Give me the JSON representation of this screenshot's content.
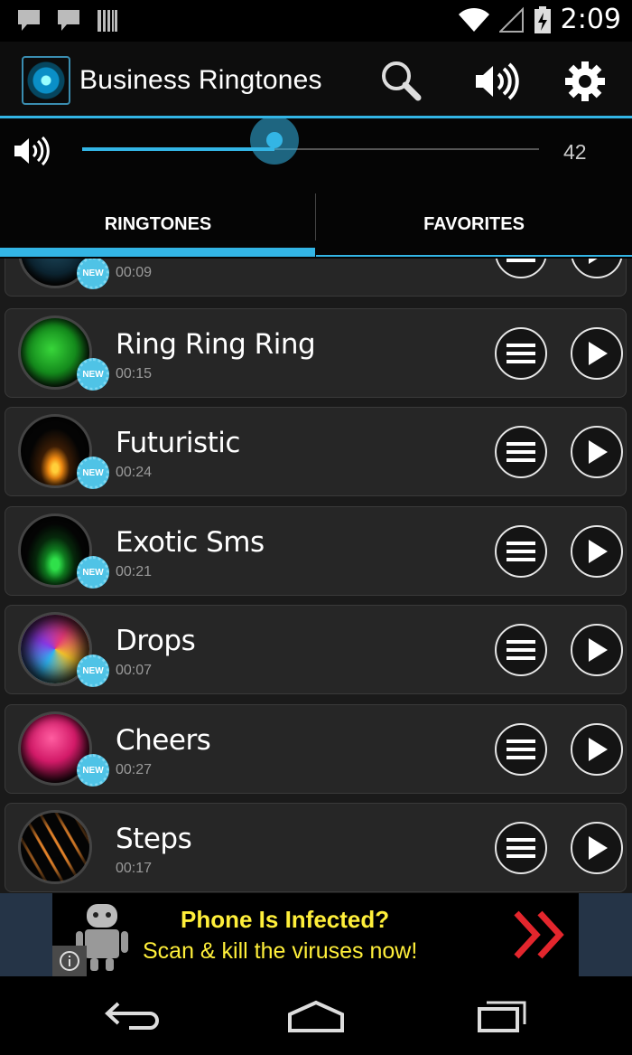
{
  "status_bar": {
    "time": "2:09",
    "icons": [
      "chat-notification-icon",
      "chat-notification-icon",
      "barcode-icon",
      "wifi-icon",
      "signal-icon",
      "battery-charging-icon"
    ]
  },
  "action_bar": {
    "title": "Business Ringtones",
    "icons": [
      "search-icon",
      "volume-icon",
      "gear-icon"
    ]
  },
  "volume": {
    "value": "42",
    "level": 0.42
  },
  "tabs": [
    {
      "label": "RINGTONES",
      "selected": true
    },
    {
      "label": "FAVORITES",
      "selected": false
    }
  ],
  "ringtones": [
    {
      "title": "",
      "duration": "00:09",
      "badge": "NEW"
    },
    {
      "title": "Ring Ring Ring",
      "duration": "00:15",
      "badge": "NEW"
    },
    {
      "title": "Futuristic",
      "duration": "00:24",
      "badge": "NEW"
    },
    {
      "title": "Exotic Sms",
      "duration": "00:21",
      "badge": "NEW"
    },
    {
      "title": "Drops",
      "duration": "00:07",
      "badge": "NEW"
    },
    {
      "title": "Cheers",
      "duration": "00:27",
      "badge": "NEW"
    },
    {
      "title": "Steps",
      "duration": "00:17",
      "badge": ""
    }
  ],
  "ad": {
    "line1": "Phone Is Infected?",
    "line2": "Scan & kill the viruses now!"
  },
  "nav_bar": {
    "icons": [
      "back-icon",
      "home-icon",
      "recent-apps-icon"
    ]
  },
  "colors": {
    "accent": "#33b5e5",
    "ad_text": "#ffef3a",
    "ad_arrows": "#e3262d"
  }
}
